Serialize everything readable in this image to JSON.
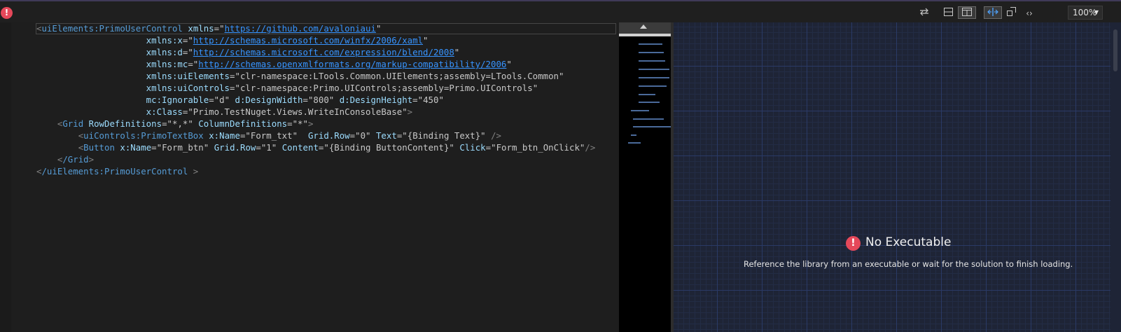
{
  "toolbar": {
    "error_glyph": "!",
    "zoom": "100%"
  },
  "code": {
    "line1": {
      "open": "<",
      "tag": "uiElements:PrimoUserControl",
      "attr": "xmlns",
      "eq": "=\"",
      "link": "https://github.com/avaloniaui",
      "close": "\""
    },
    "line2": {
      "attr": "xmlns:x",
      "link": "http://schemas.microsoft.com/winfx/2006/xaml"
    },
    "line3": {
      "attr": "xmlns:d",
      "link": "http://schemas.microsoft.com/expression/blend/2008"
    },
    "line4": {
      "attr": "xmlns:mc",
      "link": "http://schemas.openxmlformats.org/markup-compatibility/2006"
    },
    "line5": {
      "attr": "xmlns:uiElements",
      "value": "clr-namespace:LTools.Common.UIElements;assembly=LTools.Common"
    },
    "line6": {
      "attr": "xmlns:uiControls",
      "value": "clr-namespace:Primo.UIControls;assembly=Primo.UIControls"
    },
    "line7": {
      "attr1": "mc:Ignorable",
      "val1": "d",
      "attr2": "d:DesignWidth",
      "val2": "800",
      "attr3": "d:DesignHeight",
      "val3": "450"
    },
    "line8": {
      "attr": "x:Class",
      "value": "Primo.TestNuget.Views.WriteInConsoleBase",
      "end": ">"
    },
    "line9": {
      "tag": "Grid",
      "attr1": "RowDefinitions",
      "val1": "*,*",
      "attr2": "ColumnDefinitions",
      "val2": "*",
      "end": ">"
    },
    "line10": {
      "tag": "uiControls:PrimoTextBox",
      "attr1": "x:Name",
      "val1": "Form_txt",
      "attr2": "Grid.Row",
      "val2": "0",
      "attr3": "Text",
      "val3": "{Binding Text}",
      "end": " />"
    },
    "line11": {
      "tag": "Button",
      "attr1": "x:Name",
      "val1": "Form_btn",
      "attr2": "Grid.Row",
      "val2": "1",
      "attr3": "Content",
      "val3": "{Binding ButtonContent}",
      "attr4": "Click",
      "val4": "Form_btn_OnClick",
      "end": "/>"
    },
    "line12": {
      "tag": "/Grid",
      "end": ">"
    },
    "line13": {
      "tag": "/uiElements:PrimoUserControl",
      "end": " >"
    }
  },
  "designer": {
    "error_glyph": "!",
    "title": "No Executable",
    "message": "Reference the library from an executable or wait for the solution to finish loading."
  }
}
